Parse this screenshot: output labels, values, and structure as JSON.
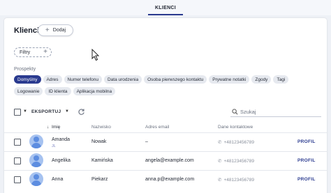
{
  "top_nav": {
    "active_tab": "KLIENCI"
  },
  "page": {
    "title": "Klienci",
    "add_label": "Dodaj",
    "filter_label": "Filtry"
  },
  "presets": {
    "label": "Prospekty",
    "row1": [
      "Domyślny",
      "Adres",
      "Numer telefonu",
      "Data urodzenia",
      "Osoba pierwszego kontaktu",
      "Prywatne notatki",
      "Zgody",
      "Tagi"
    ],
    "row2": [
      "Logowanie",
      "ID klienta",
      "Aplikacja mobilna"
    ],
    "active": "Domyślny"
  },
  "toolbar": {
    "export_label": "EKSPORTUJ",
    "search_placeholder": "Szukaj"
  },
  "table": {
    "columns": {
      "first_name": "Imię",
      "last_name": "Nazwisko",
      "email": "Adres email",
      "contact": "Dane kontaktowe"
    },
    "rows": [
      {
        "first_name": "Amanda",
        "sub": "JL",
        "last_name": "Nowak",
        "email": "–",
        "phone": "+48123456789",
        "action": "PROFIL"
      },
      {
        "first_name": "Angelika",
        "sub": "",
        "last_name": "Kamińska",
        "email": "angela@example.com",
        "phone": "+48123456789",
        "action": "PROFIL"
      },
      {
        "first_name": "Anna",
        "sub": "",
        "last_name": "Piekarz",
        "email": "anna.p@example.com",
        "phone": "+48123456789",
        "action": "PROFIL"
      }
    ]
  },
  "colors": {
    "accent": "#2a3a8f",
    "avatar": "#5d8de0"
  }
}
